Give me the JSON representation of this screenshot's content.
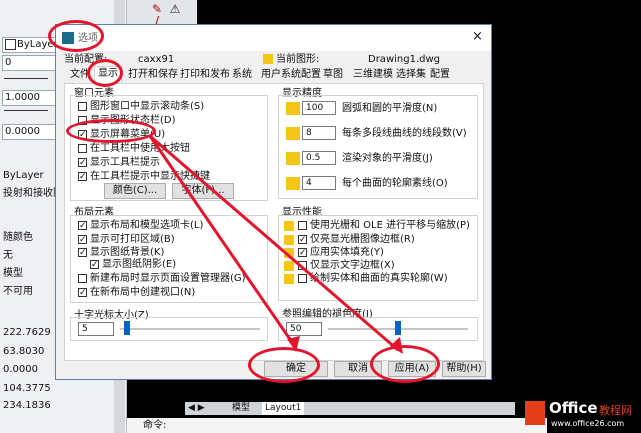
{
  "left_panel": {
    "linetype_value": "ByLayer",
    "value_0": "0",
    "value_1000": "1.0000",
    "value_0000": "0.0000",
    "bylayer_2": "ByLayer",
    "shadow_label": "投射和接收阴",
    "rows": [
      "随颜色",
      "无",
      "模型",
      "不可用"
    ],
    "coords": [
      "222.7629",
      "63.8030",
      "0.0000",
      "104.3775",
      "234.1836"
    ]
  },
  "bottom": {
    "tab_model": "模型",
    "tab_layout1": "Layout1",
    "command_label": "命令:"
  },
  "watermark": {
    "brand": "Office",
    "brand_suffix": "教程网",
    "url": "www.office26.com"
  },
  "dialog": {
    "title": "选项",
    "close_icon": "×",
    "current_config_label": "当前配置:",
    "current_config_value": "caxx91",
    "current_drawing_label": "当前图形:",
    "current_drawing_value": "Drawing1.dwg",
    "tabs": [
      "文件",
      "显示",
      "打开和保存",
      "打印和发布",
      "系统",
      "用户系统配置",
      "草图",
      "三维建模",
      "选择集",
      "配置"
    ],
    "window_elements": {
      "title": "窗口元素",
      "items": [
        {
          "label": "图形窗口中显示滚动条(S)",
          "checked": false
        },
        {
          "label": "显示图形状态栏(D)",
          "checked": false
        },
        {
          "label": "显示屏幕菜单(U)",
          "checked": true
        },
        {
          "label": "在工具栏中使用大按钮",
          "checked": false
        },
        {
          "label": "显示工具栏提示",
          "checked": true
        },
        {
          "label": "在工具栏提示中显示快捷键",
          "checked": true
        }
      ],
      "color_button": "颜色(C)...",
      "font_button": "字体(F)..."
    },
    "layout_elements": {
      "title": "布局元素",
      "items": [
        {
          "label": "显示布局和模型选项卡(L)",
          "checked": true
        },
        {
          "label": "显示可打印区域(B)",
          "checked": true
        },
        {
          "label": "显示图纸背景(K)",
          "checked": true
        },
        {
          "label": "显示图纸阴影(E)",
          "checked": true
        },
        {
          "label": "新建布局时显示页面设置管理器(G)",
          "checked": false
        },
        {
          "label": "在新布局中创建视口(N)",
          "checked": true
        }
      ]
    },
    "crosshair": {
      "title": "十字光标大小(Z)",
      "value": "5",
      "level": 5
    },
    "display_precision": {
      "title": "显示精度",
      "items": [
        {
          "value": "100",
          "label": "圆弧和圆的平滑度(N)"
        },
        {
          "value": "8",
          "label": "每条多段线曲线的线段数(V)"
        },
        {
          "value": "0.5",
          "label": "渲染对象的平滑度(J)"
        },
        {
          "value": "4",
          "label": "每个曲面的轮廓素线(O)"
        }
      ]
    },
    "display_performance": {
      "title": "显示性能",
      "items": [
        {
          "label": "使用光栅和 OLE 进行平移与缩放(P)",
          "checked": false
        },
        {
          "label": "仅亮显光栅图像边框(R)",
          "checked": true
        },
        {
          "label": "应用实体填充(Y)",
          "checked": true
        },
        {
          "label": "仅显示文字边框(X)",
          "checked": false
        },
        {
          "label": "绘制实体和曲面的真实轮廓(W)",
          "checked": false
        }
      ]
    },
    "xref_fade": {
      "title": "参照编辑的褪色度(I)",
      "value": "50",
      "level": 50
    },
    "buttons": {
      "ok": "确定",
      "cancel": "取消",
      "apply": "应用(A)",
      "help": "帮助(H)"
    }
  },
  "colors": {
    "annotation_red": "#e4142b",
    "accent_blue": "#0063c5"
  }
}
